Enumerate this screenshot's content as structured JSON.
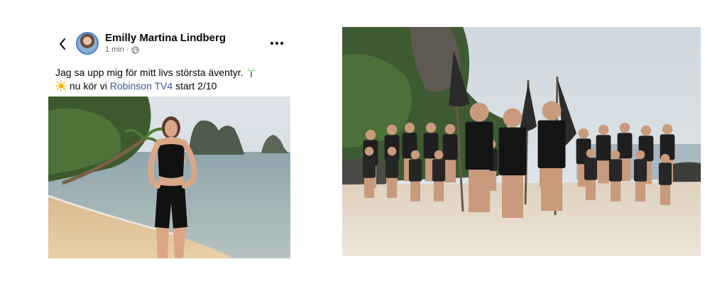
{
  "post": {
    "author": "Emilly Martina Lindberg",
    "time": "1 min",
    "separator": "·",
    "text_line1": "Jag sa upp mig för mitt livs största äventyr.",
    "text_line2_prefix": "nu kör vi",
    "link_text": "Robinson TV4",
    "text_line2_suffix": "start 2/10",
    "emoji_1": "palm-tree",
    "emoji_2": "sun"
  },
  "icons": {
    "back": "chevron-left-icon",
    "privacy": "globe-icon",
    "more": "more-dots-icon"
  },
  "colors": {
    "link": "#385898",
    "avatar_ring": "#4a7fc9",
    "meta_text": "#65676b"
  }
}
